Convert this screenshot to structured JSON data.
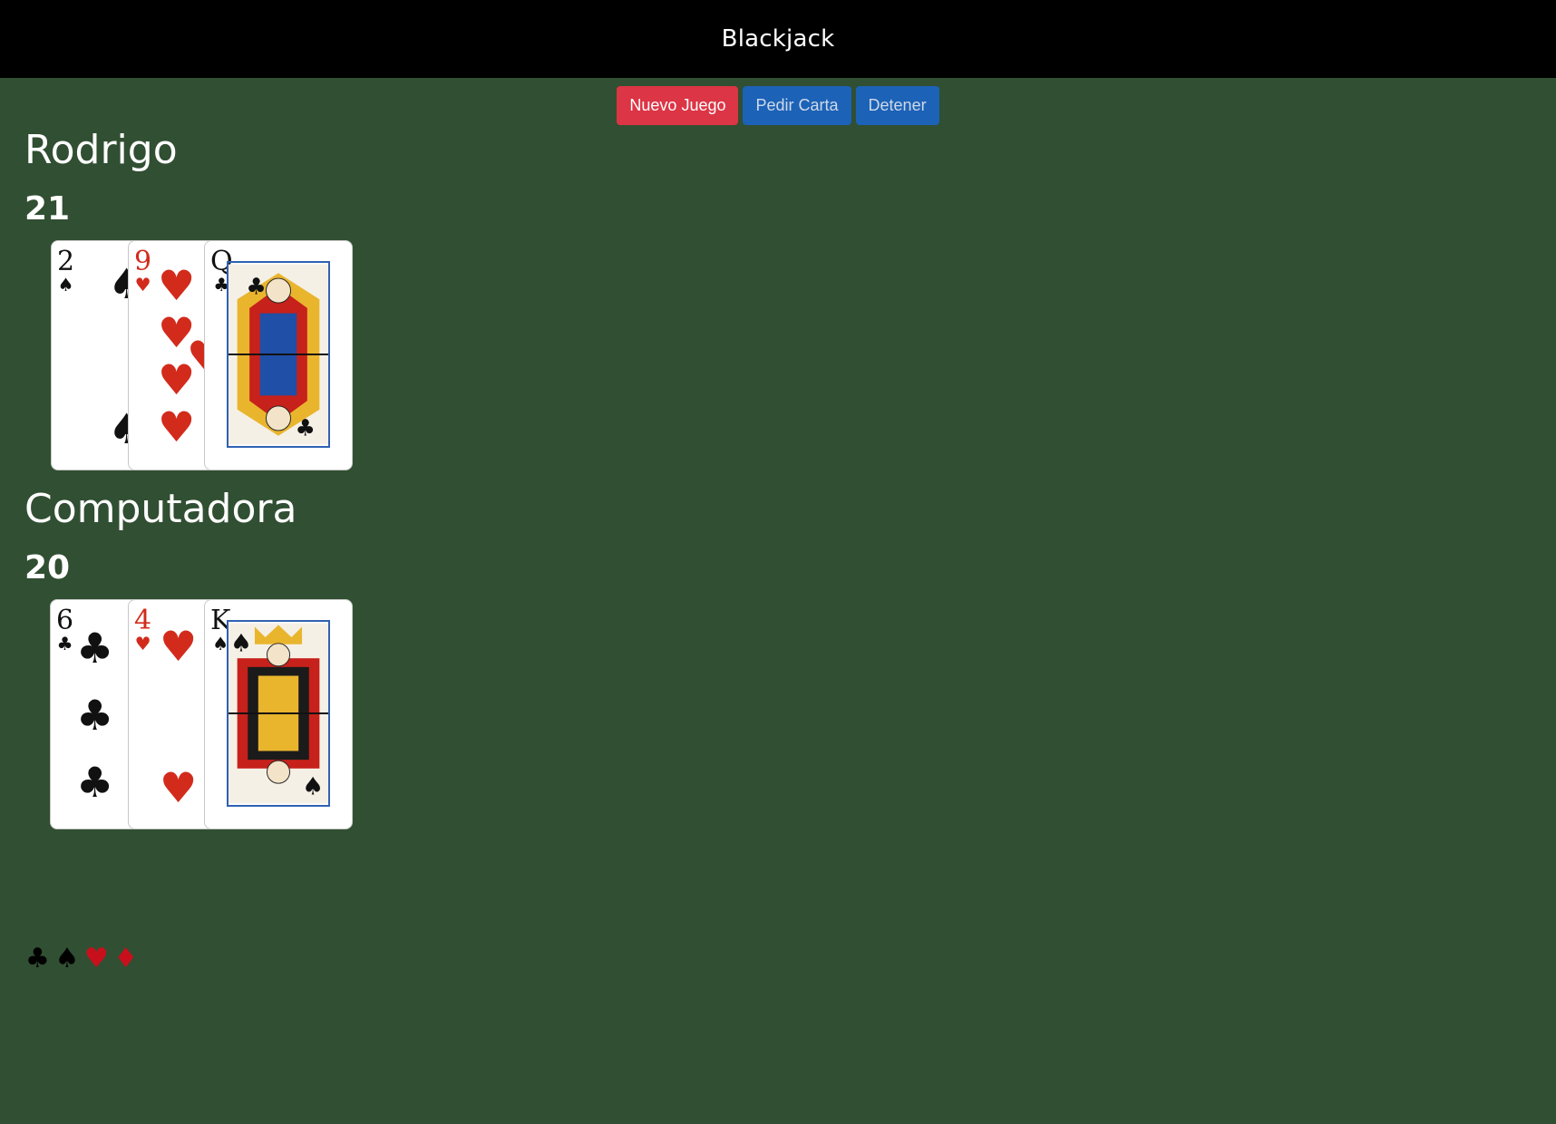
{
  "header": {
    "title": "Blackjack"
  },
  "controls": {
    "new_game": "Nuevo Juego",
    "hit": "Pedir Carta",
    "stand": "Detener"
  },
  "players": [
    {
      "name": "Rodrigo",
      "score": "21",
      "cards": [
        {
          "rank": "2",
          "suit": "♠",
          "color": "black"
        },
        {
          "rank": "9",
          "suit": "♥",
          "color": "red"
        },
        {
          "rank": "Q",
          "suit": "♣",
          "color": "black"
        }
      ]
    },
    {
      "name": "Computadora",
      "score": "20",
      "cards": [
        {
          "rank": "6",
          "suit": "♣",
          "color": "black"
        },
        {
          "rank": "4",
          "suit": "♥",
          "color": "red"
        },
        {
          "rank": "K",
          "suit": "♠",
          "color": "black"
        }
      ]
    }
  ],
  "footer_suits": [
    "♣",
    "♠",
    "♥",
    "♦"
  ],
  "colors": {
    "table": "#314f32",
    "red_suit": "#d22b1c",
    "danger": "#dc3545",
    "primary": "#1c62b7"
  }
}
